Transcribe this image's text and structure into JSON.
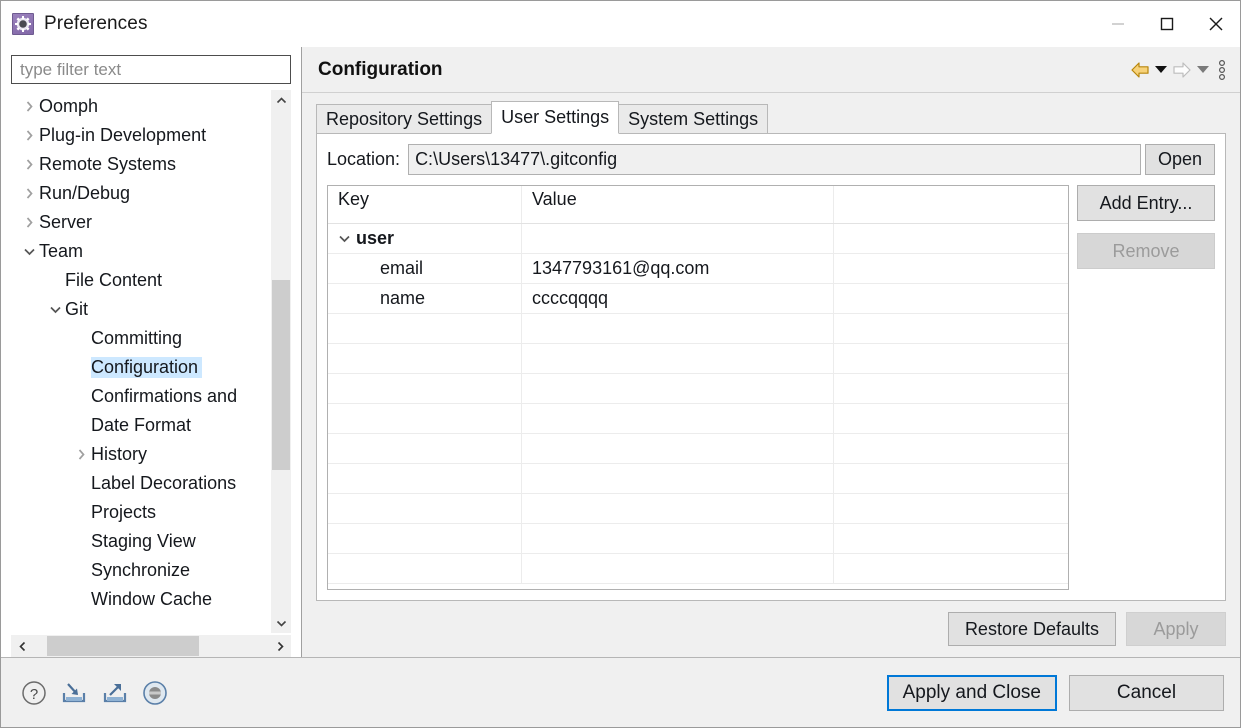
{
  "window": {
    "title": "Preferences",
    "icon": "preferences-gear-icon",
    "controls": {
      "minimize": "minimize-icon",
      "maximize": "maximize-icon",
      "close": "close-icon"
    }
  },
  "filter": {
    "placeholder": "type filter text",
    "value": ""
  },
  "tree": {
    "items": [
      {
        "label": "Oomph",
        "indent": 0,
        "state": "collapsed",
        "selected": false
      },
      {
        "label": "Plug-in Development",
        "indent": 0,
        "state": "collapsed",
        "selected": false
      },
      {
        "label": "Remote Systems",
        "indent": 0,
        "state": "collapsed",
        "selected": false
      },
      {
        "label": "Run/Debug",
        "indent": 0,
        "state": "collapsed",
        "selected": false
      },
      {
        "label": "Server",
        "indent": 0,
        "state": "collapsed",
        "selected": false
      },
      {
        "label": "Team",
        "indent": 0,
        "state": "expanded",
        "selected": false
      },
      {
        "label": "File Content",
        "indent": 1,
        "state": "leaf",
        "selected": false
      },
      {
        "label": "Git",
        "indent": 1,
        "state": "expanded",
        "selected": false
      },
      {
        "label": "Committing",
        "indent": 2,
        "state": "leaf",
        "selected": false
      },
      {
        "label": "Configuration",
        "indent": 2,
        "state": "leaf",
        "selected": true
      },
      {
        "label": "Confirmations and",
        "indent": 2,
        "state": "leaf",
        "selected": false
      },
      {
        "label": "Date Format",
        "indent": 2,
        "state": "leaf",
        "selected": false
      },
      {
        "label": "History",
        "indent": 2,
        "state": "collapsed",
        "selected": false
      },
      {
        "label": "Label Decorations",
        "indent": 2,
        "state": "leaf",
        "selected": false
      },
      {
        "label": "Projects",
        "indent": 2,
        "state": "leaf",
        "selected": false
      },
      {
        "label": "Staging View",
        "indent": 2,
        "state": "leaf",
        "selected": false
      },
      {
        "label": "Synchronize",
        "indent": 2,
        "state": "leaf",
        "selected": false
      },
      {
        "label": "Window Cache",
        "indent": 2,
        "state": "leaf",
        "selected": false
      }
    ],
    "scroll_up_icon": "chevron-up-icon",
    "scroll_down_icon": "chevron-down-icon",
    "scroll_left_icon": "chevron-left-icon",
    "scroll_right_icon": "chevron-right-icon"
  },
  "page": {
    "title": "Configuration",
    "tools": {
      "back": "back-arrow-icon",
      "back_menu": "triangle-down-icon",
      "forward": "forward-arrow-icon",
      "forward_menu": "triangle-down-icon",
      "view_menu": "vertical-dots-icon"
    },
    "tabs": [
      {
        "label": "Repository Settings",
        "active": false
      },
      {
        "label": "User Settings",
        "active": true
      },
      {
        "label": "System Settings",
        "active": false
      }
    ],
    "location": {
      "label": "Location:",
      "value": "C:\\Users\\13477\\.gitconfig",
      "open_button": "Open"
    },
    "table": {
      "columns": [
        "Key",
        "Value",
        ""
      ],
      "rows": [
        {
          "type": "group",
          "key": "user",
          "value": "",
          "expanded": true
        },
        {
          "type": "child",
          "key": "email",
          "value": "1347793161@qq.com"
        },
        {
          "type": "child",
          "key": "name",
          "value": "ccccqqqq"
        }
      ],
      "empty_row_count": 9
    },
    "side_buttons": [
      {
        "label": "Add Entry...",
        "enabled": true
      },
      {
        "label": "Remove",
        "enabled": false
      }
    ],
    "footer_buttons": [
      {
        "label": "Restore Defaults",
        "enabled": true
      },
      {
        "label": "Apply",
        "enabled": false
      }
    ]
  },
  "dialog": {
    "bottom_icons": [
      {
        "name": "help-icon",
        "glyph": "?"
      },
      {
        "name": "import-icon",
        "glyph": "import"
      },
      {
        "name": "export-icon",
        "glyph": "export"
      },
      {
        "name": "toggle-icon",
        "glyph": "circle"
      }
    ],
    "buttons": [
      {
        "label": "Apply and Close",
        "default": true
      },
      {
        "label": "Cancel",
        "default": false
      }
    ]
  }
}
